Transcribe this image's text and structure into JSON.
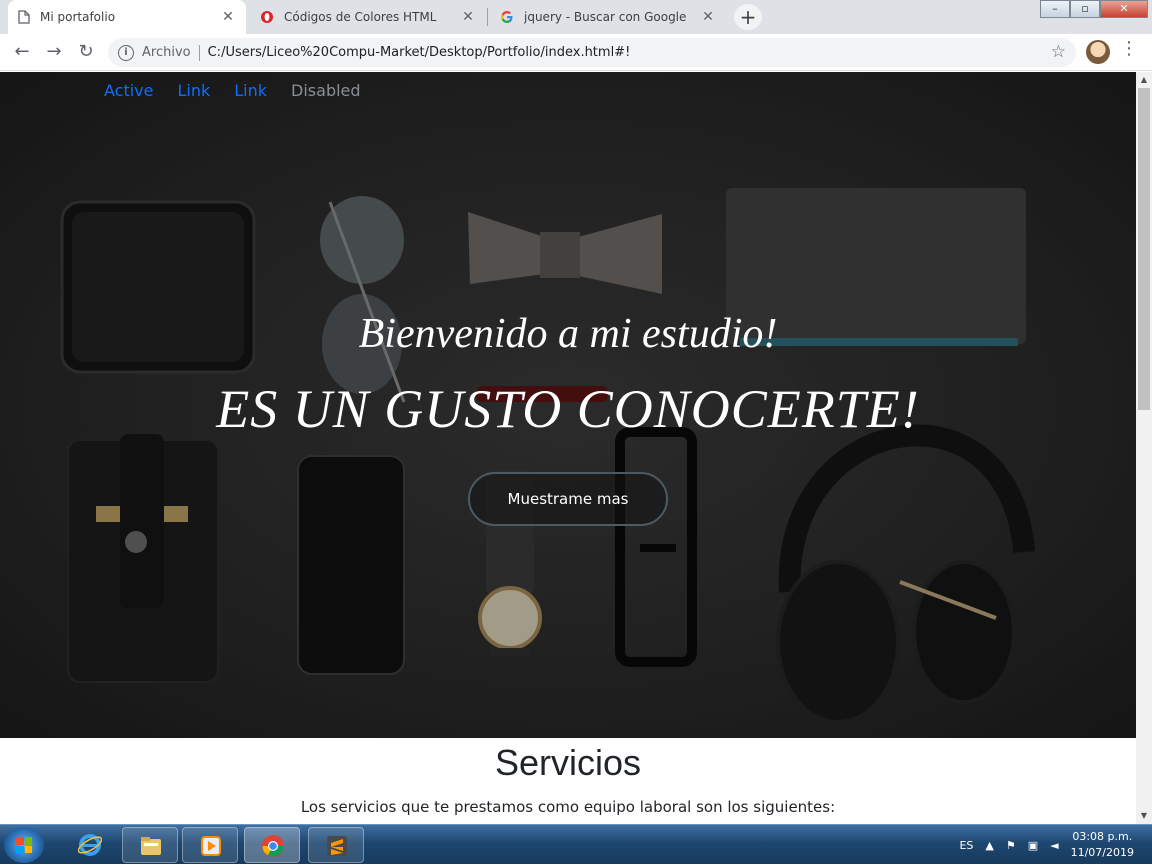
{
  "browser": {
    "tabs": [
      {
        "title": "Mi portafolio",
        "icon": "page-icon",
        "active": true
      },
      {
        "title": "Códigos de Colores HTML",
        "icon": "opera-icon",
        "active": false
      },
      {
        "title": "jquery - Buscar con Google",
        "icon": "google-icon",
        "active": false
      }
    ],
    "close_glyph": "✕",
    "new_tab_glyph": "+",
    "window_controls": {
      "minimize": "–",
      "maximize": "▫",
      "close": "✕"
    },
    "nav": {
      "back": "←",
      "forward": "→",
      "reload": "↻"
    },
    "omnibox": {
      "info_glyph": "i",
      "chip_label": "Archivo",
      "url": "C:/Users/Liceo%20Compu-Market/Desktop/Portfolio/index.html#!",
      "star_glyph": "☆"
    },
    "menu_glyph": "⋮"
  },
  "page": {
    "navbar": [
      {
        "label": "Active",
        "state": "active"
      },
      {
        "label": "Link",
        "state": "normal"
      },
      {
        "label": "Link",
        "state": "normal"
      },
      {
        "label": "Disabled",
        "state": "disabled"
      }
    ],
    "hero": {
      "subtitle": "Bienvenido a mi estudio!",
      "title": "ES UN GUSTO CONOCERTE!",
      "button_label": "Muestrame mas"
    },
    "services": {
      "title": "Servicios",
      "text": "Los servicios que te prestamos como equipo laboral son los siguientes:"
    }
  },
  "taskbar": {
    "apps": [
      "internet-explorer-icon",
      "file-explorer-icon",
      "media-player-icon",
      "chrome-icon",
      "sublime-text-icon"
    ],
    "tray": {
      "language": "ES",
      "time": "03:08 p.m.",
      "date": "11/07/2019"
    }
  },
  "colors": {
    "link": "#0d6efd",
    "disabled": "#8a8f96",
    "hero_bg": "#2a2a2a"
  }
}
